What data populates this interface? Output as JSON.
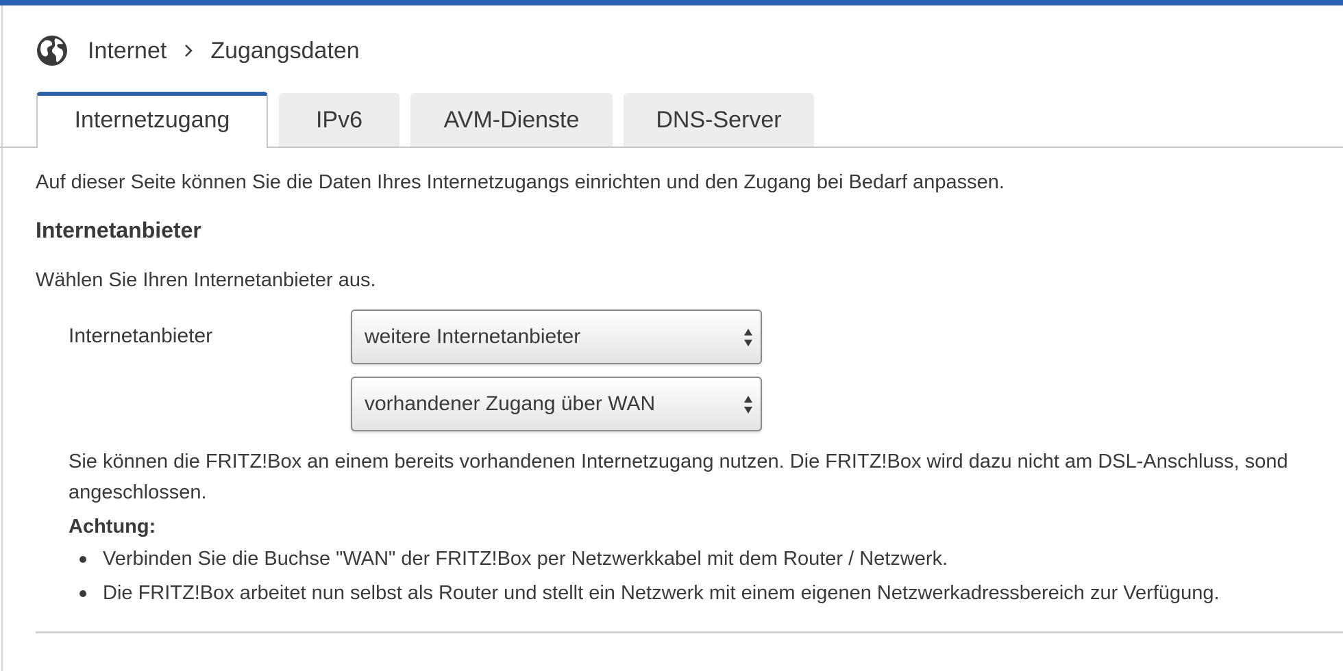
{
  "breadcrumb": {
    "icon": "globe-icon",
    "items": [
      "Internet",
      "Zugangsdaten"
    ]
  },
  "tabs": [
    {
      "label": "Internetzugang",
      "active": true
    },
    {
      "label": "IPv6",
      "active": false
    },
    {
      "label": "AVM-Dienste",
      "active": false
    },
    {
      "label": "DNS-Server",
      "active": false
    }
  ],
  "main": {
    "intro": "Auf dieser Seite können Sie die Daten Ihres Internetzugangs einrichten und den Zugang bei Bedarf anpassen.",
    "section_title": "Internetanbieter",
    "prompt": "Wählen Sie Ihren Internetanbieter aus.",
    "field_label": "Internetanbieter",
    "provider_select": "weitere Internetanbieter",
    "access_select": "vorhandener Zugang über WAN",
    "description_line1": "Sie können die FRITZ!Box an einem bereits vorhandenen Internetzugang nutzen. Die FRITZ!Box wird dazu nicht am DSL-Anschluss, sond",
    "description_line2": "angeschlossen.",
    "warning_title": "Achtung:",
    "warnings": [
      "Verbinden Sie die Buchse \"WAN\" der FRITZ!Box per Netzwerkkabel mit dem Router / Netzwerk.",
      "Die FRITZ!Box arbeitet nun selbst als Router und stellt ein Netzwerk mit einem eigenen Netzwerkadressbereich zur Verfügung."
    ]
  },
  "colors": {
    "accent": "#2a62b1",
    "text": "#3a3a3a",
    "tab_inactive": "#ededed",
    "divider": "#c8c8c8"
  }
}
